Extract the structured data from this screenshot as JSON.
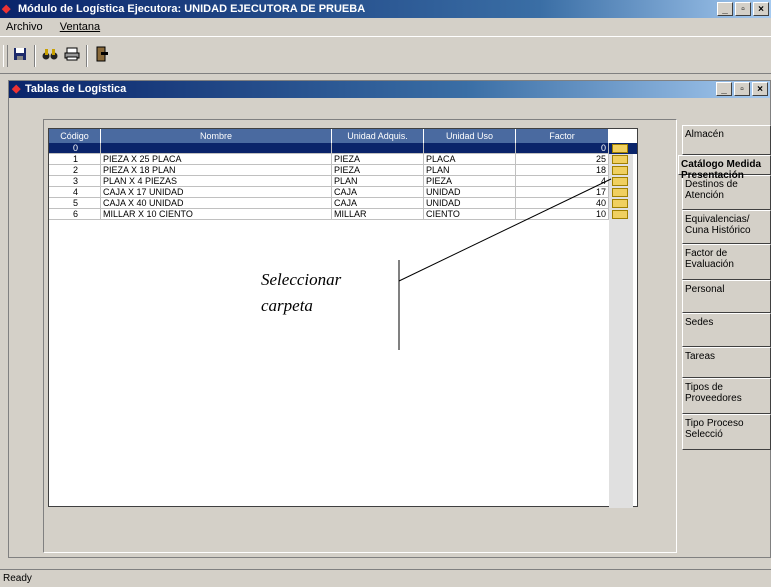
{
  "window": {
    "title": "Módulo de Logística   Ejecutora: UNIDAD EJECUTORA DE PRUEBA",
    "buttons": [
      "_",
      "▫",
      "×"
    ]
  },
  "menu": [
    {
      "label": "Archivo"
    },
    {
      "label": "Ventana"
    }
  ],
  "toolbar": {
    "icons": [
      "save-icon",
      "binoculars-icon",
      "print-icon",
      "exit-icon"
    ]
  },
  "child_window": {
    "title": "Tablas de Logística",
    "buttons": [
      "_",
      "▫",
      "×"
    ]
  },
  "grid": {
    "columns": [
      "Código",
      "Nombre",
      "Unidad Adquis.",
      "Unidad Uso",
      "Factor"
    ],
    "rows": [
      {
        "codigo": "0",
        "nombre": "",
        "unidad_adq": "",
        "unidad_uso": "",
        "factor": "0",
        "selected": true
      },
      {
        "codigo": "1",
        "nombre": "PIEZA X 25 PLACA",
        "unidad_adq": "PIEZA",
        "unidad_uso": "PLACA",
        "factor": "25"
      },
      {
        "codigo": "2",
        "nombre": "PIEZA X 18 PLAN",
        "unidad_adq": "PIEZA",
        "unidad_uso": "PLAN",
        "factor": "18"
      },
      {
        "codigo": "3",
        "nombre": "PLAN X 4 PIEZAS",
        "unidad_adq": "PLAN",
        "unidad_uso": "PIEZA",
        "factor": "4"
      },
      {
        "codigo": "4",
        "nombre": "CAJA X 17 UNIDAD",
        "unidad_adq": "CAJA",
        "unidad_uso": "UNIDAD",
        "factor": "17"
      },
      {
        "codigo": "5",
        "nombre": "CAJA X 40 UNIDAD",
        "unidad_adq": "CAJA",
        "unidad_uso": "UNIDAD",
        "factor": "40"
      },
      {
        "codigo": "6",
        "nombre": "MILLAR X 10 CIENTO",
        "unidad_adq": "MILLAR",
        "unidad_uso": "CIENTO",
        "factor": "10"
      }
    ]
  },
  "callout": {
    "line1": "Seleccionar",
    "line2": "carpeta"
  },
  "tabs": [
    {
      "label": "Almacén"
    },
    {
      "label": "Catálogo Medida Presentación",
      "active": true
    },
    {
      "label": "Destinos de Atención"
    },
    {
      "label": "Equivalencias/ Cuna Histórico"
    },
    {
      "label": "Factor de Evaluación"
    },
    {
      "label": "Personal"
    },
    {
      "label": "Sedes"
    },
    {
      "label": "Tareas"
    },
    {
      "label": "Tipos de Proveedores"
    },
    {
      "label": "Tipo Proceso Selecció"
    }
  ],
  "status": {
    "text": "Ready"
  }
}
